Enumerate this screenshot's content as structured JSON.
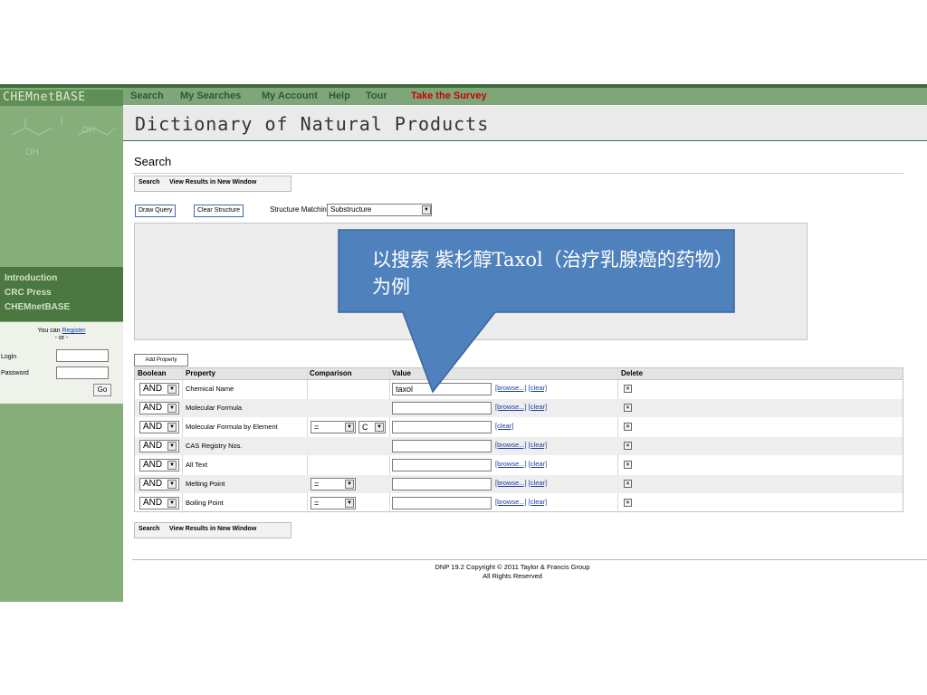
{
  "app": {
    "brand": "CHEMnetBASE",
    "page_title": "Dictionary of Natural Products"
  },
  "menu": {
    "items": [
      "Search",
      "My Searches",
      "My Account",
      "Help",
      "Tour"
    ],
    "survey": "Take the Survey",
    "survey_color": "#cc0000"
  },
  "sidebar": {
    "molecule_label": "OH",
    "molecule_label_2": "OH",
    "nav": [
      "Introduction",
      "CRC Press",
      "CHEMnetBASE"
    ],
    "register_prefix": "You can",
    "register_link": "Register",
    "or": "- or -",
    "login_label": "Login",
    "password_label": "Password",
    "go": "Go"
  },
  "search": {
    "heading": "Search",
    "search_btn": "Search",
    "new_window_btn": "View Results in New Window",
    "draw_query": "Draw Query",
    "clear_structure": "Clear Structure",
    "structure_matching_label": "Structure Matching:",
    "structure_matching_value": "Substructure",
    "add_property": "Add Property"
  },
  "table": {
    "headers": [
      "Boolean",
      "Property",
      "Comparison",
      "Value",
      "Delete"
    ],
    "rows": [
      {
        "boolean": "AND",
        "property": "Chemical Name",
        "value": "taxol",
        "browse": "[browse...]",
        "clear": "[clear]"
      },
      {
        "boolean": "AND",
        "property": "Molecular Formula",
        "value": "",
        "browse": "[browse...]",
        "clear": "[clear]"
      },
      {
        "boolean": "AND",
        "property": "Molecular Formula by Element",
        "cmp_op": "=",
        "cmp_elem": "C",
        "value": "",
        "browse": "",
        "clear": "[clear]"
      },
      {
        "boolean": "AND",
        "property": "CAS Registry Nos.",
        "value": "",
        "browse": "[browse...]",
        "clear": "[clear]"
      },
      {
        "boolean": "AND",
        "property": "All Text",
        "value": "",
        "browse": "[browse...]",
        "clear": "[clear]"
      },
      {
        "boolean": "AND",
        "property": "Melting Point",
        "cmp_op": "=",
        "value": "",
        "browse": "[browse...]",
        "clear": "[clear]"
      },
      {
        "boolean": "AND",
        "property": "Boiling Point",
        "cmp_op": "=",
        "value": "",
        "browse": "[browse...]",
        "clear": "[clear]"
      }
    ]
  },
  "footer": {
    "line1": "DNP 19.2 Copyright © 2011 Taylor & Francis Group",
    "line2": "All Rights Reserved"
  },
  "callout": {
    "text": "以搜索 紫杉醇Taxol（治疗乳腺癌的药物）为例",
    "fill": "#4f81bd"
  }
}
